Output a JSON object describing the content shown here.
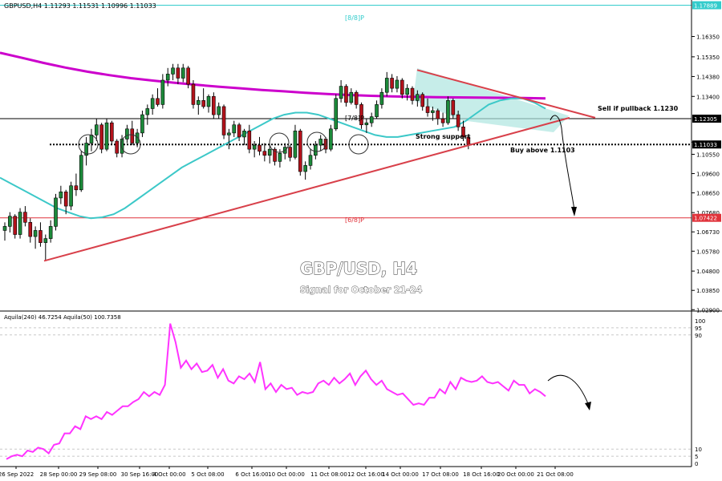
{
  "header": {
    "symbol_line": "GBPUSD,H4  1.11293 1.11531 1.10996 1.11033",
    "indicator_line": "Aquila(240) 46.7254  Aquila(50) 100.7358"
  },
  "labels": {
    "title": "GBP/USD, H4",
    "subtitle": "Signal for October 21-24",
    "sell_note": "Sell if pullback 1.1230",
    "support_note": "Strong support",
    "buy_note": "Buy above 1.1103",
    "murray_top": "[8/8]P",
    "murray_mid": "[7/8]P",
    "murray_low": "[6/8]P"
  },
  "colors": {
    "bull": "#1c8a3a",
    "bear": "#b3121b",
    "ma_fast": "#3cc8c8",
    "ma_slow": "#cc00cc",
    "trendline": "#d8404a",
    "aquila": "#ff33ff",
    "murray_top": "#33cccc",
    "murray_low": "#e0333b"
  },
  "chart_data": [
    {
      "type": "candlestick",
      "title": "GBP/USD, H4",
      "subtitle": "Signal for October 21-24",
      "ylim": [
        1.0295,
        1.1795
      ],
      "y_ticks": [
        1.1635,
        1.1535,
        1.1438,
        1.134,
        1.1115,
        1.1055,
        1.096,
        1.0865,
        1.0768,
        1.0673,
        1.0578,
        1.048,
        1.0385,
        1.029
      ],
      "x_ticks": [
        "26 Sep 2022",
        "28 Sep 00:00",
        "29 Sep 08:00",
        "30 Sep 16:00",
        "4 Oct 00:00",
        "5 Oct 08:00",
        "6 Oct 16:00",
        "10 Oct 00:00",
        "11 Oct 08:00",
        "12 Oct 16:00",
        "14 Oct 00:00",
        "17 Oct 08:00",
        "18 Oct 16:00",
        "20 Oct 00:00",
        "21 Oct 08:00"
      ],
      "price_tags": [
        {
          "value": 1.1789,
          "label": "1.17889",
          "color": "#33cccc"
        },
        {
          "value": 1.12305,
          "label": "1.12305",
          "color": "#000000"
        },
        {
          "value": 1.11033,
          "label": "1.11033",
          "color": "#000000"
        },
        {
          "value": 1.07422,
          "label": "1.07422",
          "color": "#e0333b"
        }
      ],
      "murray_levels": [
        {
          "name": "[8/8]P",
          "value": 1.1789
        },
        {
          "name": "[7/8]P",
          "value": 1.12305
        },
        {
          "name": "[6/8]P",
          "value": 1.07422
        }
      ],
      "current_price": 1.11033,
      "ohlc": [
        [
          1.068,
          1.072,
          1.063,
          1.07
        ],
        [
          1.07,
          1.077,
          1.067,
          1.075
        ],
        [
          1.075,
          1.076,
          1.064,
          1.066
        ],
        [
          1.066,
          1.079,
          1.064,
          1.077
        ],
        [
          1.077,
          1.08,
          1.07,
          1.072
        ],
        [
          1.072,
          1.074,
          1.062,
          1.065
        ],
        [
          1.065,
          1.07,
          1.059,
          1.068
        ],
        [
          1.068,
          1.072,
          1.06,
          1.062
        ],
        [
          1.062,
          1.066,
          1.053,
          1.064
        ],
        [
          1.064,
          1.073,
          1.062,
          1.07
        ],
        [
          1.07,
          1.086,
          1.068,
          1.084
        ],
        [
          1.084,
          1.09,
          1.081,
          1.087
        ],
        [
          1.087,
          1.088,
          1.076,
          1.08
        ],
        [
          1.08,
          1.092,
          1.078,
          1.09
        ],
        [
          1.09,
          1.096,
          1.085,
          1.088
        ],
        [
          1.088,
          1.107,
          1.087,
          1.105
        ],
        [
          1.105,
          1.114,
          1.1,
          1.111
        ],
        [
          1.111,
          1.118,
          1.107,
          1.115
        ],
        [
          1.115,
          1.123,
          1.112,
          1.12
        ],
        [
          1.12,
          1.121,
          1.106,
          1.108
        ],
        [
          1.108,
          1.123,
          1.107,
          1.121
        ],
        [
          1.121,
          1.122,
          1.11,
          1.112
        ],
        [
          1.112,
          1.113,
          1.104,
          1.106
        ],
        [
          1.106,
          1.115,
          1.104,
          1.113
        ],
        [
          1.113,
          1.12,
          1.111,
          1.118
        ],
        [
          1.118,
          1.122,
          1.11,
          1.111
        ],
        [
          1.111,
          1.118,
          1.109,
          1.116
        ],
        [
          1.116,
          1.127,
          1.114,
          1.125
        ],
        [
          1.125,
          1.13,
          1.12,
          1.128
        ],
        [
          1.128,
          1.135,
          1.125,
          1.133
        ],
        [
          1.133,
          1.138,
          1.129,
          1.13
        ],
        [
          1.13,
          1.145,
          1.128,
          1.142
        ],
        [
          1.142,
          1.148,
          1.139,
          1.145
        ],
        [
          1.145,
          1.15,
          1.142,
          1.148
        ],
        [
          1.148,
          1.15,
          1.14,
          1.143
        ],
        [
          1.143,
          1.15,
          1.141,
          1.148
        ],
        [
          1.148,
          1.149,
          1.138,
          1.14
        ],
        [
          1.14,
          1.142,
          1.128,
          1.13
        ],
        [
          1.13,
          1.134,
          1.125,
          1.132
        ],
        [
          1.132,
          1.138,
          1.128,
          1.129
        ],
        [
          1.129,
          1.135,
          1.126,
          1.134
        ],
        [
          1.134,
          1.136,
          1.123,
          1.125
        ],
        [
          1.125,
          1.131,
          1.123,
          1.129
        ],
        [
          1.129,
          1.13,
          1.113,
          1.115
        ],
        [
          1.115,
          1.118,
          1.108,
          1.116
        ],
        [
          1.116,
          1.122,
          1.114,
          1.12
        ],
        [
          1.12,
          1.121,
          1.112,
          1.114
        ],
        [
          1.114,
          1.118,
          1.11,
          1.117
        ],
        [
          1.117,
          1.12,
          1.106,
          1.108
        ],
        [
          1.108,
          1.112,
          1.104,
          1.11
        ],
        [
          1.11,
          1.114,
          1.105,
          1.107
        ],
        [
          1.107,
          1.111,
          1.102,
          1.105
        ],
        [
          1.105,
          1.11,
          1.101,
          1.108
        ],
        [
          1.108,
          1.109,
          1.1,
          1.102
        ],
        [
          1.102,
          1.108,
          1.099,
          1.106
        ],
        [
          1.106,
          1.111,
          1.103,
          1.109
        ],
        [
          1.109,
          1.11,
          1.102,
          1.104
        ],
        [
          1.104,
          1.12,
          1.103,
          1.117
        ],
        [
          1.117,
          1.118,
          1.095,
          1.097
        ],
        [
          1.097,
          1.102,
          1.093,
          1.1
        ],
        [
          1.1,
          1.108,
          1.098,
          1.105
        ],
        [
          1.105,
          1.112,
          1.103,
          1.11
        ],
        [
          1.11,
          1.115,
          1.107,
          1.113
        ],
        [
          1.113,
          1.114,
          1.106,
          1.108
        ],
        [
          1.108,
          1.12,
          1.107,
          1.118
        ],
        [
          1.118,
          1.135,
          1.117,
          1.133
        ],
        [
          1.133,
          1.142,
          1.131,
          1.139
        ],
        [
          1.139,
          1.14,
          1.129,
          1.131
        ],
        [
          1.131,
          1.138,
          1.13,
          1.136
        ],
        [
          1.136,
          1.137,
          1.128,
          1.13
        ],
        [
          1.13,
          1.131,
          1.118,
          1.12
        ],
        [
          1.12,
          1.123,
          1.116,
          1.121
        ],
        [
          1.121,
          1.126,
          1.119,
          1.124
        ],
        [
          1.124,
          1.132,
          1.123,
          1.13
        ],
        [
          1.13,
          1.138,
          1.128,
          1.136
        ],
        [
          1.136,
          1.146,
          1.134,
          1.143
        ],
        [
          1.143,
          1.145,
          1.136,
          1.138
        ],
        [
          1.138,
          1.144,
          1.136,
          1.142
        ],
        [
          1.142,
          1.143,
          1.133,
          1.135
        ],
        [
          1.135,
          1.14,
          1.132,
          1.138
        ],
        [
          1.138,
          1.139,
          1.13,
          1.132
        ],
        [
          1.132,
          1.137,
          1.129,
          1.135
        ],
        [
          1.135,
          1.136,
          1.127,
          1.129
        ],
        [
          1.129,
          1.133,
          1.124,
          1.126
        ],
        [
          1.126,
          1.129,
          1.122,
          1.127
        ],
        [
          1.127,
          1.128,
          1.12,
          1.123
        ],
        [
          1.123,
          1.126,
          1.119,
          1.121
        ],
        [
          1.121,
          1.134,
          1.12,
          1.132
        ],
        [
          1.132,
          1.133,
          1.123,
          1.125
        ],
        [
          1.125,
          1.127,
          1.117,
          1.119
        ],
        [
          1.119,
          1.122,
          1.112,
          1.114
        ],
        [
          1.114,
          1.115,
          1.108,
          1.1103
        ]
      ],
      "ma_fast": [
        1.094,
        1.091,
        1.088,
        1.085,
        1.082,
        1.079,
        1.077,
        1.075,
        1.074,
        1.0745,
        1.076,
        1.079,
        1.083,
        1.087,
        1.091,
        1.095,
        1.099,
        1.102,
        1.105,
        1.108,
        1.111,
        1.114,
        1.117,
        1.12,
        1.123,
        1.125,
        1.126,
        1.126,
        1.125,
        1.123,
        1.121,
        1.119,
        1.117,
        1.115,
        1.114,
        1.114,
        1.115,
        1.116,
        1.117,
        1.118,
        1.119,
        1.122,
        1.126,
        1.13,
        1.132,
        1.133,
        1.133,
        1.131,
        1.128
      ],
      "ma_slow": [
        1.1555,
        1.153,
        1.1505,
        1.1482,
        1.1462,
        1.1445,
        1.143,
        1.1418,
        1.1407,
        1.1397,
        1.1388,
        1.138,
        1.1372,
        1.1365,
        1.1358,
        1.1352,
        1.1347,
        1.1343,
        1.134,
        1.1338,
        1.1336,
        1.1335,
        1.1334,
        1.1333,
        1.1332,
        1.133
      ],
      "support_line": {
        "from": [
          6,
          1.053
        ],
        "to": [
          101,
          1.123
        ]
      },
      "resistance_line": {
        "from": [
          73,
          1.147
        ],
        "to": [
          106,
          1.125
        ]
      },
      "forecast_target": 1.07422
    },
    {
      "type": "line",
      "name": "Aquila(240)",
      "value_label": "46.7254",
      "ylim": [
        0,
        100
      ],
      "y_ticks": [
        100,
        95,
        90,
        10,
        5,
        0
      ],
      "values": [
        3,
        5,
        6,
        5,
        9,
        8,
        11,
        10,
        7,
        13,
        14,
        21,
        21,
        26,
        24,
        33,
        31,
        33,
        31,
        36,
        34,
        37,
        40,
        40,
        43,
        45,
        50,
        47,
        50,
        48,
        55,
        98,
        85,
        67,
        72,
        66,
        70,
        64,
        65,
        69,
        60,
        66,
        58,
        56,
        61,
        59,
        63,
        57,
        71,
        52,
        56,
        50,
        55,
        52,
        53,
        48,
        50,
        49,
        50,
        56,
        58,
        55,
        60,
        56,
        59,
        63,
        55,
        61,
        65,
        59,
        55,
        58,
        52,
        50,
        48,
        49,
        45,
        41,
        42,
        41,
        46,
        46,
        52,
        49,
        57,
        52,
        60,
        58,
        57,
        58,
        61,
        57,
        56,
        57,
        54,
        51,
        58,
        55,
        55,
        49,
        52,
        50,
        47
      ]
    }
  ]
}
